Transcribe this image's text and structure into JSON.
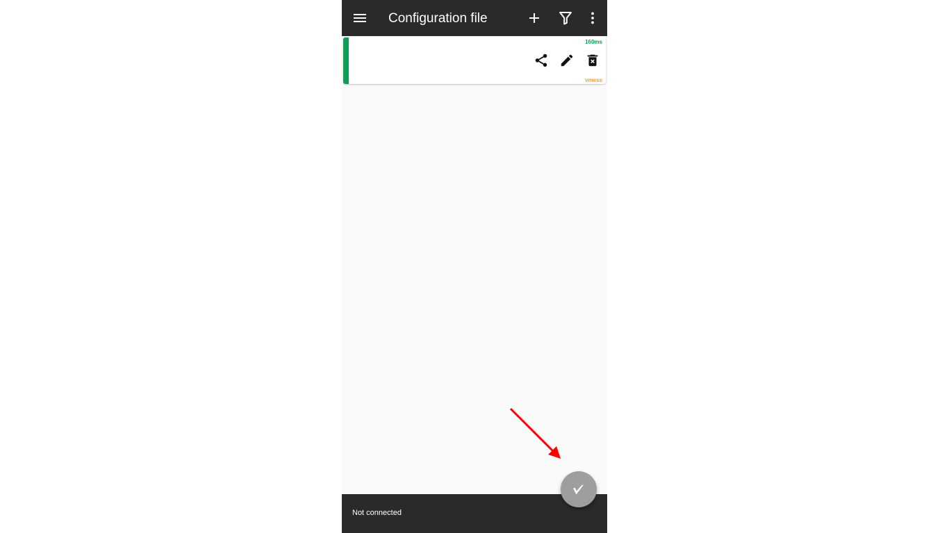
{
  "app": {
    "title": "Configuration file"
  },
  "toolbar": {
    "icons": [
      "menu-icon",
      "add-icon",
      "filter-icon",
      "more-vert-icon"
    ]
  },
  "server_list": [
    {
      "name": "",
      "address": "",
      "latency": "160ms",
      "type": "vmess",
      "status_color": "#0f9d58",
      "actions": [
        "share-icon",
        "edit-icon",
        "delete-icon"
      ]
    }
  ],
  "status_bar": {
    "text": "Not connected"
  },
  "fab": {
    "icon": "v-logo-icon",
    "color": "#9e9e9e"
  },
  "colors": {
    "appbar": "#2a2a2a",
    "accent_green": "#0f9d58",
    "type_orange": "#f0a030",
    "annotation_arrow": "#ff0000"
  }
}
